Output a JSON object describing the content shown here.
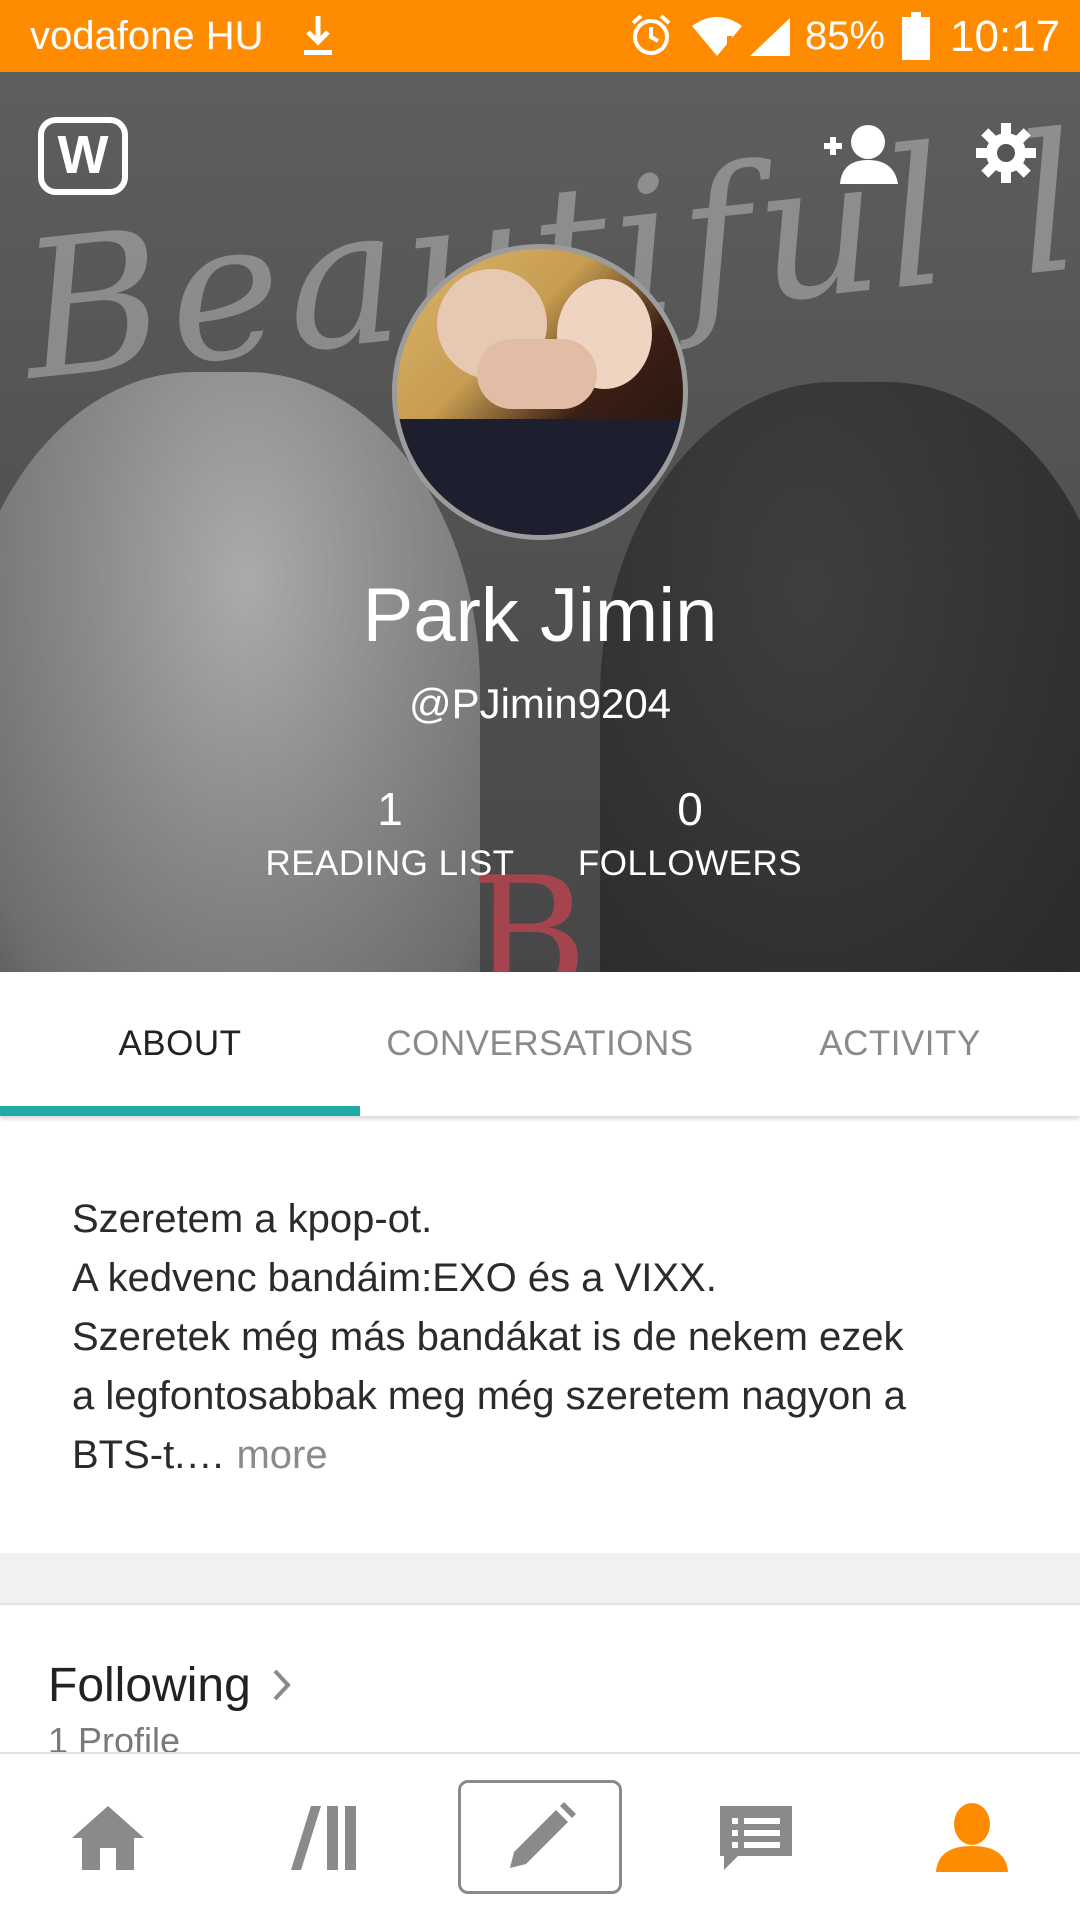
{
  "status_bar": {
    "carrier": "vodafone HU",
    "battery": "85%",
    "time": "10:17",
    "icons": [
      "download-icon",
      "alarm-icon",
      "wifi-icon",
      "signal-icon",
      "battery-icon"
    ]
  },
  "header": {
    "background_text": "Beautiful liar",
    "logo_letter": "W",
    "name": "Park Jimin",
    "handle": "@PJimin9204",
    "stats": [
      {
        "value": "1",
        "label": "READING LIST"
      },
      {
        "value": "0",
        "label": "FOLLOWERS"
      }
    ],
    "icons": [
      "add-friend-icon",
      "settings-icon"
    ]
  },
  "tabs": [
    {
      "label": "ABOUT",
      "active": true
    },
    {
      "label": "CONVERSATIONS",
      "active": false
    },
    {
      "label": "ACTIVITY",
      "active": false
    }
  ],
  "about": {
    "text": "Szeretem a kpop-ot.\nA kedvenc bandáim:EXO és a VIXX.\nSzeretek még más bandákat is de nekem ezek\na legfontosabbak meg még szeretem nagyon a\nBTS-t.…",
    "more": " more"
  },
  "following": {
    "title": "Following",
    "subtitle": "1 Profile"
  },
  "bottom_nav": {
    "items": [
      "home-icon",
      "library-icon",
      "write-icon",
      "messages-icon",
      "profile-icon"
    ],
    "active": "profile-icon"
  },
  "colors": {
    "status_bar": "#ff8c00",
    "tab_indicator": "#1fa9a7",
    "active_nav": "#ff8c00"
  }
}
